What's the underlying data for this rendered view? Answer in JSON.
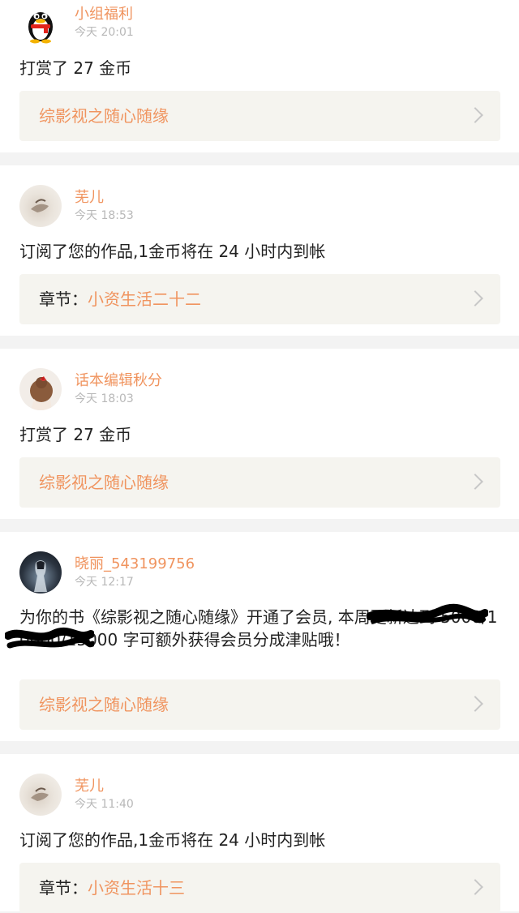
{
  "items": [
    {
      "name": "小组福利",
      "time": "今天 20:01",
      "message": "打赏了 27 金币",
      "link_prefix": "",
      "link_label": "综影视之随心随缘",
      "avatar": "qq-penguin-avatar"
    },
    {
      "name": "芜儿",
      "time": "今天 18:53",
      "message": "订阅了您的作品,1金币将在 24 小时内到帐",
      "link_prefix": "章节：",
      "link_label": "小资生活二十二",
      "avatar": "photo-avatar"
    },
    {
      "name": "话本编辑秋分",
      "time": "今天 18:03",
      "message": "打赏了 27 金币",
      "link_prefix": "",
      "link_label": "综影视之随心随缘",
      "avatar": "girl-bun-avatar"
    },
    {
      "name": "晓丽_543199756",
      "time": "今天 12:17",
      "message": "为你的书《综影视之随心随缘》开通了会员,                       本周更新达到 5000/10000/15000 字可额外获得会员分成津贴哦！",
      "link_prefix": "",
      "link_label": "综影视之随心随缘",
      "avatar": "dark-figure-avatar"
    },
    {
      "name": "芜儿",
      "time": "今天 11:40",
      "message": "订阅了您的作品,1金币将在 24 小时内到帐",
      "link_prefix": "章节：",
      "link_label": "小资生活十三",
      "avatar": "photo-avatar"
    }
  ],
  "colors": {
    "accent": "#f0945f",
    "time": "#b8b8b8",
    "link_bg": "#f5f4ef",
    "page_bg": "#f3f3f3",
    "card_bg": "#ffffff",
    "redaction": "#000000"
  }
}
